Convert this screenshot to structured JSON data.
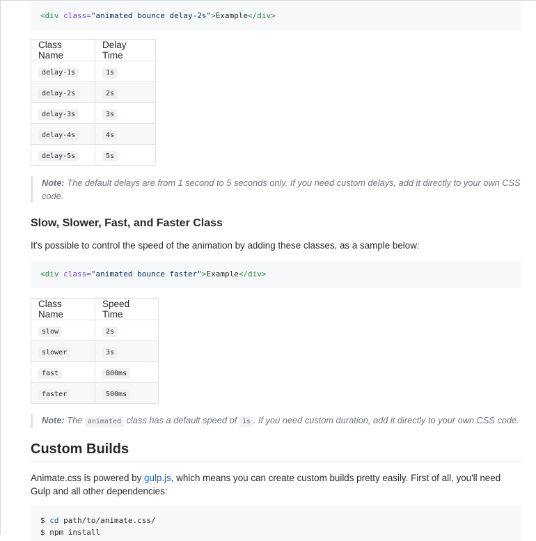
{
  "code1": {
    "open_tag": "<div",
    "class_attr": "class=",
    "class_value": "\"animated bounce delay-2s\"",
    "gt": ">",
    "content": "Example",
    "close_tag": "</div>"
  },
  "delay_table": {
    "headers": [
      "Class Name",
      "Delay Time"
    ],
    "rows": [
      [
        "delay-1s",
        "1s"
      ],
      [
        "delay-2s",
        "2s"
      ],
      [
        "delay-3s",
        "3s"
      ],
      [
        "delay-4s",
        "4s"
      ],
      [
        "delay-5s",
        "5s"
      ]
    ]
  },
  "note1": {
    "label": "Note:",
    "text": " The default delays are from 1 second to 5 seconds only. If you need custom delays, add it directly to your own CSS code."
  },
  "speed_section": {
    "heading": "Slow, Slower, Fast, and Faster Class",
    "intro": "It's possible to control the speed of the animation by adding these classes, as a sample below:"
  },
  "code2": {
    "open_tag": "<div",
    "class_attr": "class=",
    "class_value": "\"animated bounce faster\"",
    "gt": ">",
    "content": "Example",
    "close_tag": "</div>"
  },
  "speed_table": {
    "headers": [
      "Class Name",
      "Speed Time"
    ],
    "rows": [
      [
        "slow",
        "2s"
      ],
      [
        "slower",
        "3s"
      ],
      [
        "fast",
        "800ms"
      ],
      [
        "faster",
        "500ms"
      ]
    ]
  },
  "note2": {
    "label": "Note:",
    "text_a": " The ",
    "code_a": "animated",
    "text_b": " class has a default speed of ",
    "code_b": "1s",
    "text_c": ". If you need custom duration, add it directly to your own CSS code."
  },
  "custom_builds": {
    "heading": "Custom Builds",
    "para_a": "Animate.css is powered by ",
    "link": "gulp.js",
    "para_b": ", which means you can create custom builds pretty easily. First of all, you'll need Gulp and all other dependencies:"
  },
  "code3": {
    "line1_prompt": "$ ",
    "line1_cmd": "cd",
    "line1_arg": " path/to/animate.css/",
    "line2": "$ npm install"
  }
}
